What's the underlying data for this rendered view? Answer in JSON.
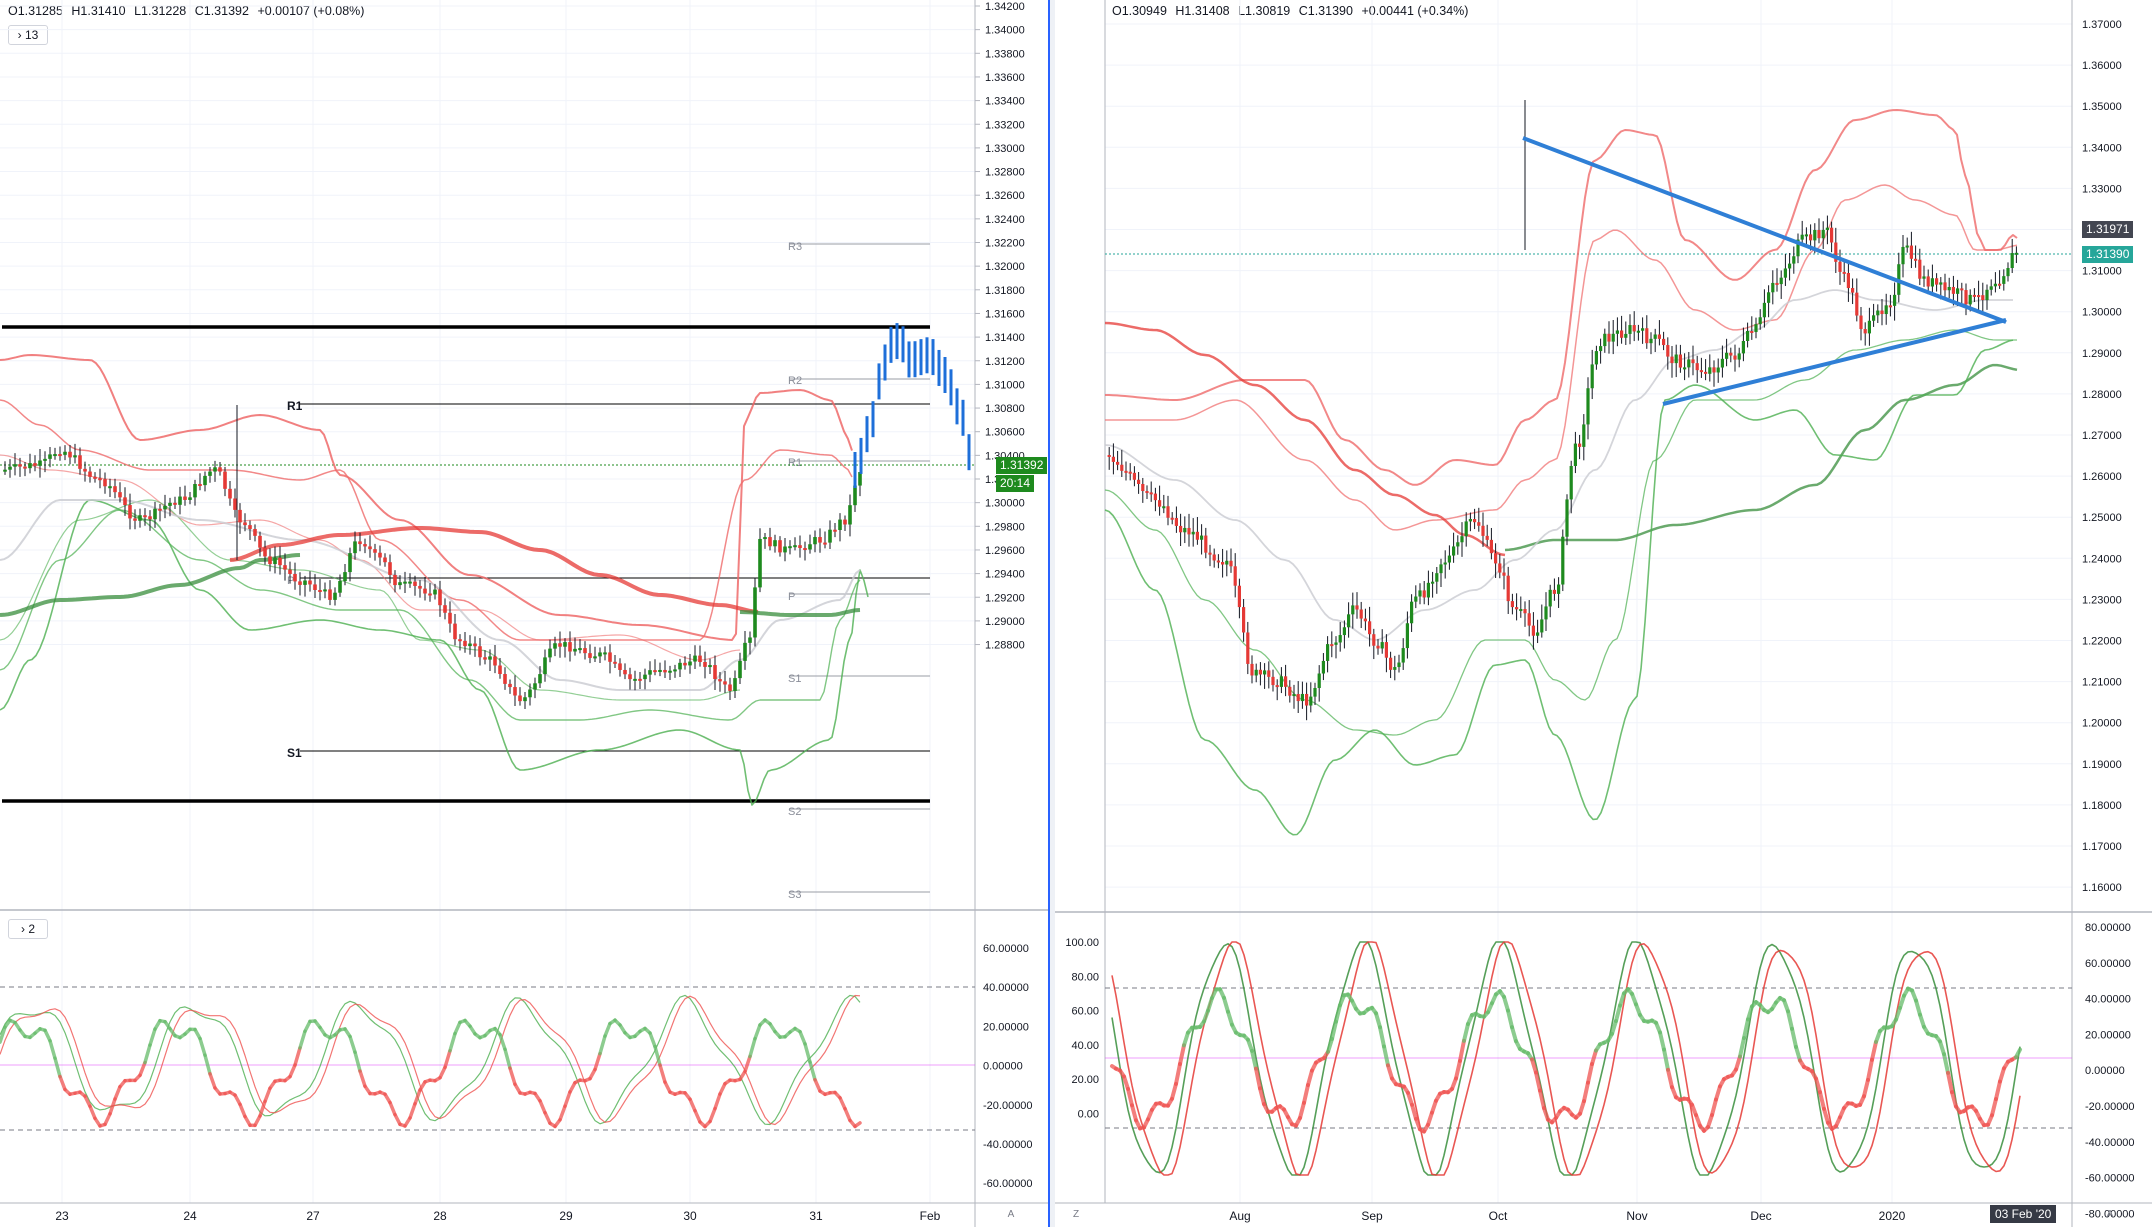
{
  "left": {
    "ohlc": {
      "o": "O1.31285",
      "h": "H1.31410",
      "l": "L1.31228",
      "c": "C1.31392",
      "chg": "+0.00107 (+0.08%)"
    },
    "main_toggle": "13",
    "osc_toggle": "2",
    "price_ticks": [
      "1.34200",
      "1.34000",
      "1.33800",
      "1.33600",
      "1.33400",
      "1.33200",
      "1.33000",
      "1.32800",
      "1.32600",
      "1.32400",
      "1.32200",
      "1.32000",
      "1.31800",
      "1.31600",
      "1.31400",
      "1.31200",
      "1.31000",
      "1.30800",
      "1.30600",
      "1.30400",
      "1.30200",
      "1.30000",
      "1.29800",
      "1.29600",
      "1.29400",
      "1.29200",
      "1.29000",
      "1.28800"
    ],
    "osc_ticks": [
      "60.00000",
      "40.00000",
      "20.00000",
      "0.00000",
      "-20.00000",
      "-40.00000",
      "-60.00000"
    ],
    "time_ticks": [
      "23",
      "24",
      "27",
      "28",
      "29",
      "30",
      "31",
      "Feb"
    ],
    "pivots": {
      "r3": "R3",
      "r2": "R2",
      "r1": "R1",
      "p": "P",
      "s1": "S1",
      "s2": "S2",
      "s3": "S3",
      "r1_bold": "R1",
      "s1_bold": "S1",
      "p_bold": "P"
    },
    "last_price": "1.31392",
    "countdown": "20:14",
    "auto_btn": "A",
    "colors": {
      "last": "#1e8a1e",
      "upper_band": "#ef6a6a",
      "lower_band": "#4caf50"
    }
  },
  "right": {
    "ohlc": {
      "o": "O1.30949",
      "h": "H1.31408",
      "l": "L1.30819",
      "c": "C1.31390",
      "chg": "+0.00441 (+0.34%)"
    },
    "price_ticks": [
      "1.37000",
      "1.36000",
      "1.35000",
      "1.34000",
      "1.33000",
      "1.32000",
      "1.31000",
      "1.30000",
      "1.29000",
      "1.28000",
      "1.27000",
      "1.26000",
      "1.25000",
      "1.24000",
      "1.23000",
      "1.22000",
      "1.21000",
      "1.20000",
      "1.19000",
      "1.18000",
      "1.17000",
      "1.16000"
    ],
    "osc_left_ticks": [
      "100.00",
      "80.00",
      "60.00",
      "40.00",
      "20.00",
      "0.00"
    ],
    "osc_right_ticks": [
      "80.00000",
      "60.00000",
      "40.00000",
      "20.00000",
      "0.00000",
      "-20.00000",
      "-40.00000",
      "-60.00000",
      "-80.00000"
    ],
    "time_ticks": [
      "Aug",
      "Sep",
      "Oct",
      "Nov",
      "Dec",
      "2020"
    ],
    "badge_upper": "1.31971",
    "badge_last": "1.31390",
    "date_badge": "03 Feb '20",
    "auto_btn": "A",
    "z_btn": "Z",
    "colors": {
      "badge_upper": "#434651",
      "badge_last": "#26a69a",
      "triangle": "#2f7fd6"
    }
  }
}
